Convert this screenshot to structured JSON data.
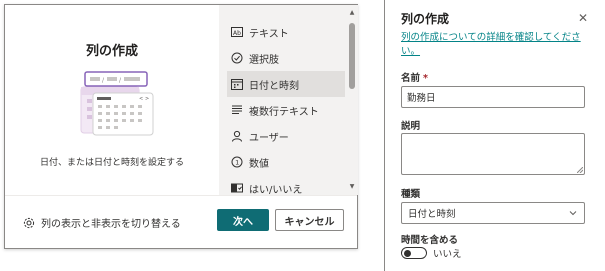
{
  "dialog": {
    "title": "列の作成",
    "description": "日付、または日付と時刻を設定する",
    "column_types": [
      {
        "label": "テキスト",
        "icon": "text-icon",
        "selected": false
      },
      {
        "label": "選択肢",
        "icon": "choice-check-icon",
        "selected": false
      },
      {
        "label": "日付と時刻",
        "icon": "calendar-icon",
        "selected": true
      },
      {
        "label": "複数行テキスト",
        "icon": "multiline-text-icon",
        "selected": false
      },
      {
        "label": "ユーザー",
        "icon": "person-icon",
        "selected": false
      },
      {
        "label": "数値",
        "icon": "number-icon",
        "selected": false
      },
      {
        "label": "はい/いいえ",
        "icon": "yes-no-icon",
        "selected": false
      }
    ],
    "toggle_visibility_label": "列の表示と非表示を切り替える",
    "next_button": "次へ",
    "cancel_button": "キャンセル",
    "accent_color": "#0f6c74"
  },
  "panel": {
    "title": "列の作成",
    "learn_more_link": "列の作成についての詳細を確認してください。",
    "name_label": "名前",
    "required_marker": "*",
    "name_value": "勤務日",
    "description_label": "説明",
    "description_value": "",
    "type_label": "種類",
    "type_value": "日付と時刻",
    "include_time_label": "時間を含める",
    "include_time_state": "いいえ",
    "link_color": "#038387"
  }
}
